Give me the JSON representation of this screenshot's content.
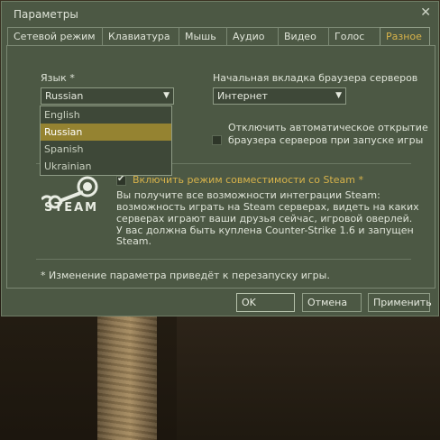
{
  "window": {
    "title": "Параметры",
    "close_icon": "close-icon"
  },
  "tabs": [
    {
      "label": "Сетевой режим"
    },
    {
      "label": "Клавиатура"
    },
    {
      "label": "Мышь"
    },
    {
      "label": "Аудио"
    },
    {
      "label": "Видео"
    },
    {
      "label": "Голос"
    },
    {
      "label": "Разное",
      "active": true
    }
  ],
  "language": {
    "label": "Язык *",
    "value": "Russian",
    "options": [
      "English",
      "Russian",
      "Spanish",
      "Ukrainian"
    ],
    "selected": "Russian"
  },
  "server_browser": {
    "label": "Начальная вкладка браузера серверов",
    "value": "Интернет",
    "auto_open_checkbox": {
      "label_line1": "Отключить автоматическое открытие",
      "label_line2": "браузера серверов при запуске игры",
      "checked": false
    }
  },
  "steam": {
    "logo_text": "STEAM",
    "compat_checkbox": {
      "label": "Включить режим совместимости со Steam *",
      "checked": true
    },
    "desc_lines": [
      "Вы получите все возможности интеграции Steam:",
      "возможность играть на Steam серверах, видеть на каких",
      "серверах играют ваши друзья сейчас, игровой оверлей.",
      "У вас должна быть куплена Counter-Strike 1.6 и запущен",
      "Steam."
    ]
  },
  "footnote": "* Изменение параметра приведёт к перезапуску игры.",
  "buttons": {
    "ok": "OK",
    "cancel": "Отмена",
    "apply": "Применить"
  },
  "colors": {
    "panel": "#4c5844",
    "accent_tab": "#d7b24a",
    "selected_option": "#958331"
  }
}
